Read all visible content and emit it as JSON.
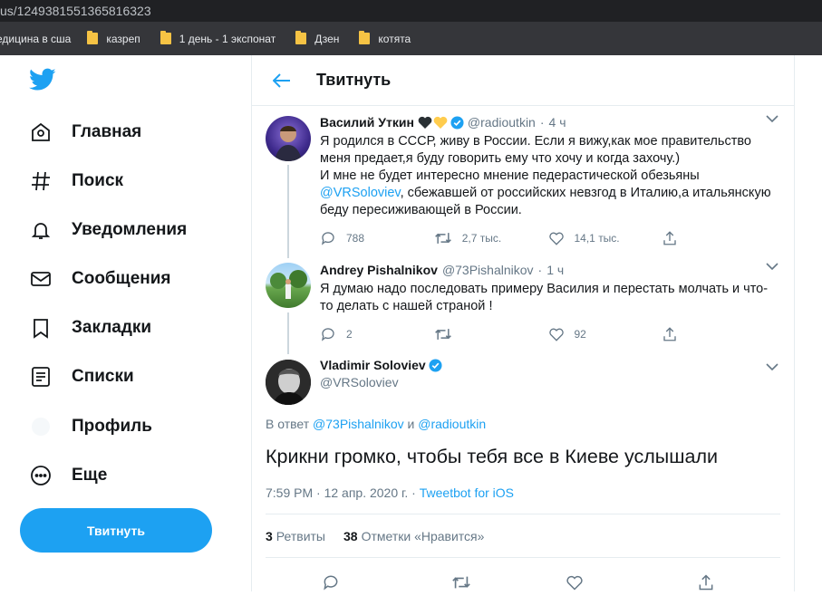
{
  "browser": {
    "url": "us/1249381551365816323",
    "bookmarks": [
      {
        "label": "едицина в сша"
      },
      {
        "label": "казреп"
      },
      {
        "label": "1 день - 1 экспонат"
      },
      {
        "label": "Дзен"
      },
      {
        "label": "котята"
      }
    ]
  },
  "sidebar": {
    "items": [
      {
        "label": "Главная",
        "icon": "home-icon"
      },
      {
        "label": "Поиск",
        "icon": "hashtag-icon"
      },
      {
        "label": "Уведомления",
        "icon": "bell-icon"
      },
      {
        "label": "Сообщения",
        "icon": "envelope-icon"
      },
      {
        "label": "Закладки",
        "icon": "bookmark-icon"
      },
      {
        "label": "Списки",
        "icon": "list-icon"
      },
      {
        "label": "Профиль",
        "icon": "profile-icon"
      },
      {
        "label": "Еще",
        "icon": "more-icon"
      }
    ],
    "tweet_button": "Твитнуть"
  },
  "header": {
    "title": "Твитнуть"
  },
  "thread": [
    {
      "name": "Василий Уткин",
      "handle": "@radioutkin",
      "dot": "·",
      "time": "4 ч",
      "text_1": "Я родился в СССР, живу в России. Если я вижу,как мое правительство меня предает,я буду говорить ему что хочу и когда захочу.)",
      "text_2": "И мне не будет интересно мнение педерастической обезьяны",
      "mention": "@VRSoloviev",
      "text_3": ", сбежавшей от российских невзгод в Италию,а итальянскую беду пересиживающей в России.",
      "replies": "788",
      "retweets": "2,7 тыс.",
      "likes": "14,1 тыс."
    },
    {
      "name": "Andrey Pishalnikov",
      "handle": "@73Pishalnikov",
      "dot": "·",
      "time": "1 ч",
      "text": "Я думаю надо последовать примеру Василия и перестать молчать и что-то делать с нашей страной !",
      "replies": "2",
      "retweets": "",
      "likes": "92"
    }
  ],
  "focus": {
    "name": "Vladimir Soloviev",
    "handle": "@VRSoloviev",
    "reply_prefix": "В ответ",
    "reply_user1": "@73Pishalnikov",
    "reply_and": "и",
    "reply_user2": "@radioutkin",
    "text": "Крикни громко, чтобы тебя все в Киеве услышали",
    "time": "7:59 PM · 12 апр. 2020 г. ·",
    "client": "Tweetbot for iOS",
    "retweets_count": "3",
    "retweets_label": "Ретвиты",
    "likes_count": "38",
    "likes_label": "Отметки «Нравится»"
  },
  "colors": {
    "accent": "#1da1f2",
    "text": "#14171a",
    "muted": "#657786"
  }
}
